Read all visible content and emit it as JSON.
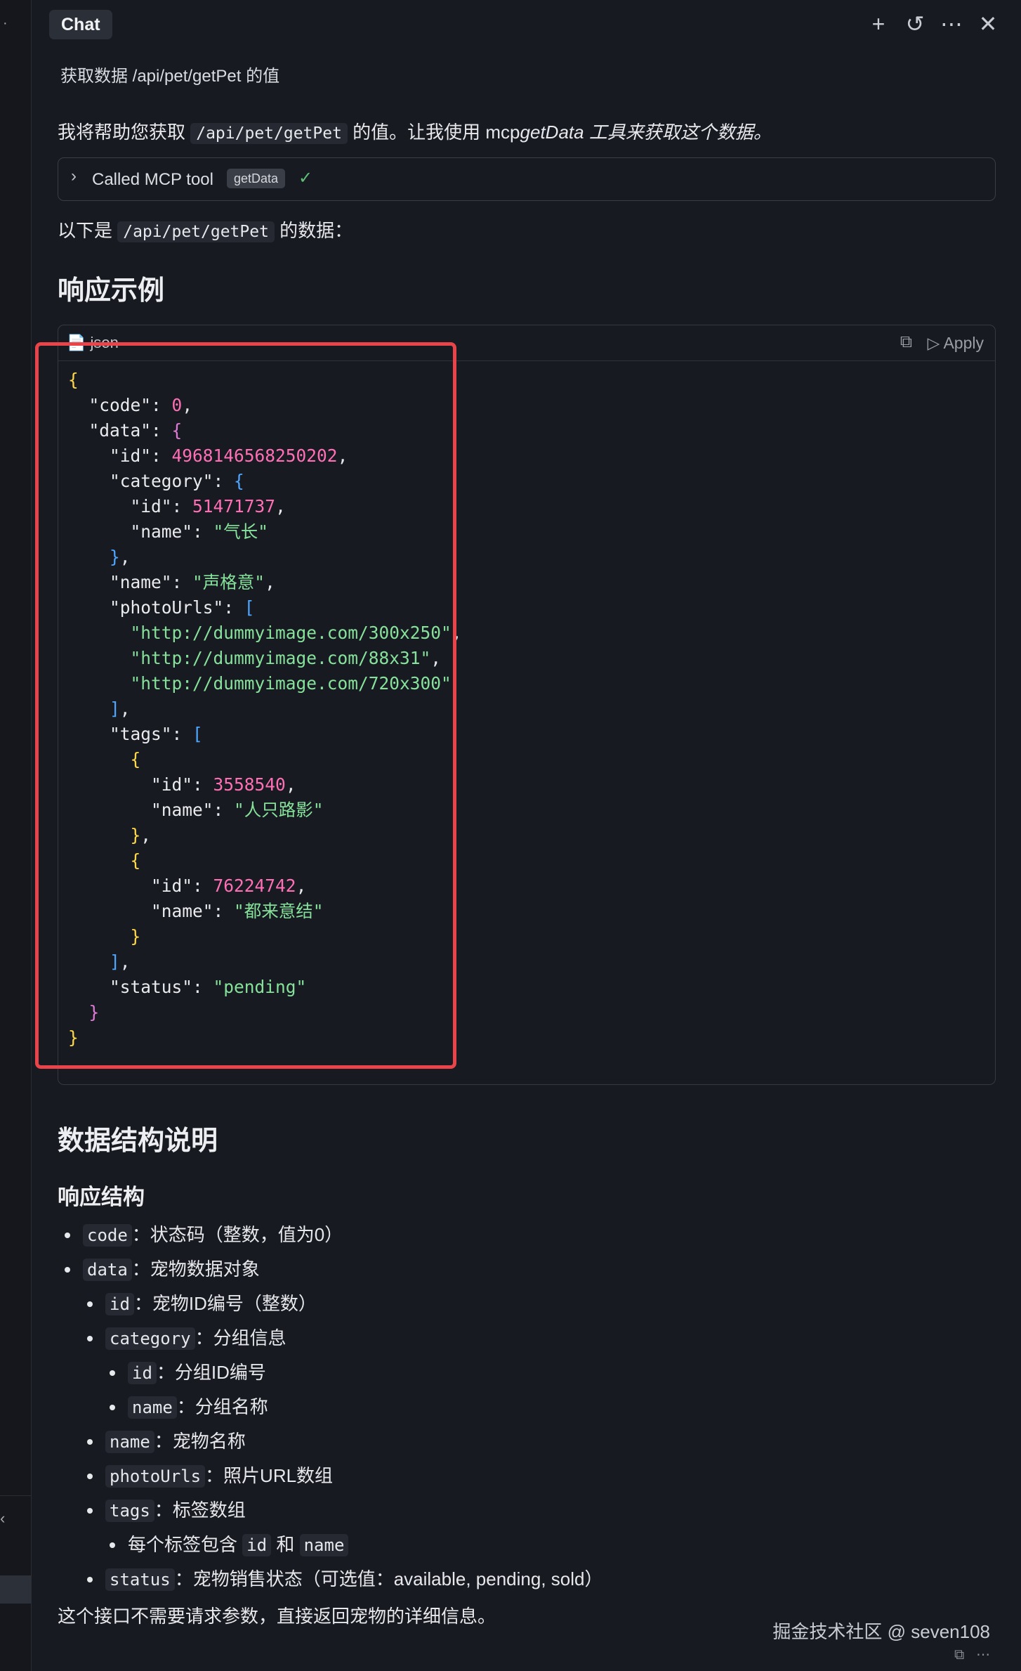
{
  "tab": {
    "label": "Chat"
  },
  "user_message": "获取数据 /api/pet/getPet 的值",
  "intro": {
    "before": "我将帮助您获取 ",
    "code": "/api/pet/getPet",
    "middle": " 的值。让我使用 mcp",
    "italic": "getData 工具来获取这个数据。"
  },
  "mcp": {
    "label": "Called MCP tool",
    "tool": "getData"
  },
  "data_line": {
    "before": "以下是 ",
    "code": "/api/pet/getPet",
    "after": " 的数据："
  },
  "heading_example": "响应示例",
  "code_block": {
    "lang": "json",
    "apply_label": "Apply"
  },
  "json": {
    "code_key": "\"code\"",
    "code_val": "0",
    "data_key": "\"data\"",
    "id_key": "\"id\"",
    "id_val": "4968146568250202",
    "category_key": "\"category\"",
    "cat_id_key": "\"id\"",
    "cat_id_val": "51471737",
    "cat_name_key": "\"name\"",
    "cat_name_val": "\"气长\"",
    "name_key": "\"name\"",
    "name_val": "\"声格意\"",
    "photo_key": "\"photoUrls\"",
    "url1": "\"http://dummyimage.com/300x250\"",
    "url2": "\"http://dummyimage.com/88x31\"",
    "url3": "\"http://dummyimage.com/720x300\"",
    "tags_key": "\"tags\"",
    "t1_id_key": "\"id\"",
    "t1_id_val": "3558540",
    "t1_name_key": "\"name\"",
    "t1_name_val": "\"人只路影\"",
    "t2_id_key": "\"id\"",
    "t2_id_val": "76224742",
    "t2_name_key": "\"name\"",
    "t2_name_val": "\"都来意结\"",
    "status_key": "\"status\"",
    "status_val": "\"pending\""
  },
  "heading_structure": "数据结构说明",
  "heading_response": "响应结构",
  "fields": {
    "code": {
      "key": "code",
      "desc": "：状态码（整数，值为0）"
    },
    "data": {
      "key": "data",
      "desc": "：宠物数据对象"
    },
    "id": {
      "key": "id",
      "desc": "：宠物ID编号（整数）"
    },
    "category": {
      "key": "category",
      "desc": "：分组信息"
    },
    "cat_id": {
      "key": "id",
      "desc": "：分组ID编号"
    },
    "cat_name": {
      "key": "name",
      "desc": "：分组名称"
    },
    "name": {
      "key": "name",
      "desc": "：宠物名称"
    },
    "photoUrls": {
      "key": "photoUrls",
      "desc": "：照片URL数组"
    },
    "tags": {
      "key": "tags",
      "desc": "：标签数组"
    },
    "tags_item": {
      "before": "每个标签包含 ",
      "id": "id",
      "and": " 和 ",
      "name": "name"
    },
    "status": {
      "key": "status",
      "desc": "：宠物销售状态（可选值：available, pending, sold）"
    }
  },
  "summary": "这个接口不需要请求参数，直接返回宠物的详细信息。",
  "watermark": "掘金技术社区 @ seven108",
  "colors": {
    "background": "#181a21",
    "number": "#ff6fb5",
    "string": "#86e29b",
    "highlight_box": "#e8444a"
  }
}
